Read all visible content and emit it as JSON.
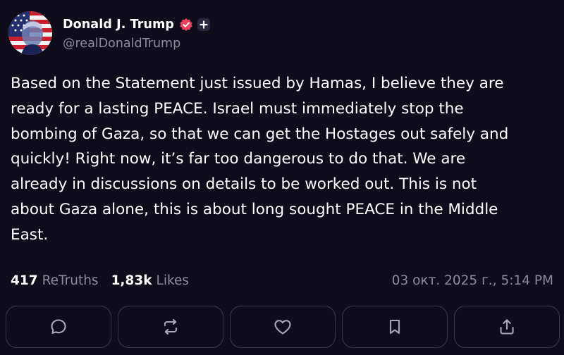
{
  "author": {
    "display_name": "Donald J. Trump",
    "handle": "@realDonaldTrump",
    "avatar_icon": "flag-portrait-avatar",
    "verified_icon": "verified-badge-icon",
    "verified_color": "#e8455c"
  },
  "post": {
    "text": "Based on the Statement just issued by Hamas, I believe they are\nready for a lasting PEACE. Israel must immediately stop the\nbombing of Gaza, so that we can get the Hostages out safely and\nquickly! Right now, it’s far too dangerous to do that. We are\nalready in discussions on details to be worked out. This is not\nabout Gaza alone, this is about long sought PEACE in the Middle\nEast."
  },
  "stats": {
    "retruths_count": "417",
    "retruths_label": "ReTruths",
    "likes_count": "1,83k",
    "likes_label": "Likes",
    "timestamp": "03 окт. 2025 г., 5:14 PM"
  },
  "actions": [
    {
      "name": "reply",
      "icon": "comment-icon"
    },
    {
      "name": "retruth",
      "icon": "retruth-icon"
    },
    {
      "name": "like",
      "icon": "heart-icon"
    },
    {
      "name": "bookmark",
      "icon": "bookmark-icon"
    },
    {
      "name": "share",
      "icon": "share-icon"
    }
  ],
  "colors": {
    "background": "#0f0d1c",
    "text_primary": "#ffffff",
    "text_secondary": "#8e8a9f",
    "button_border": "#3a3650"
  }
}
